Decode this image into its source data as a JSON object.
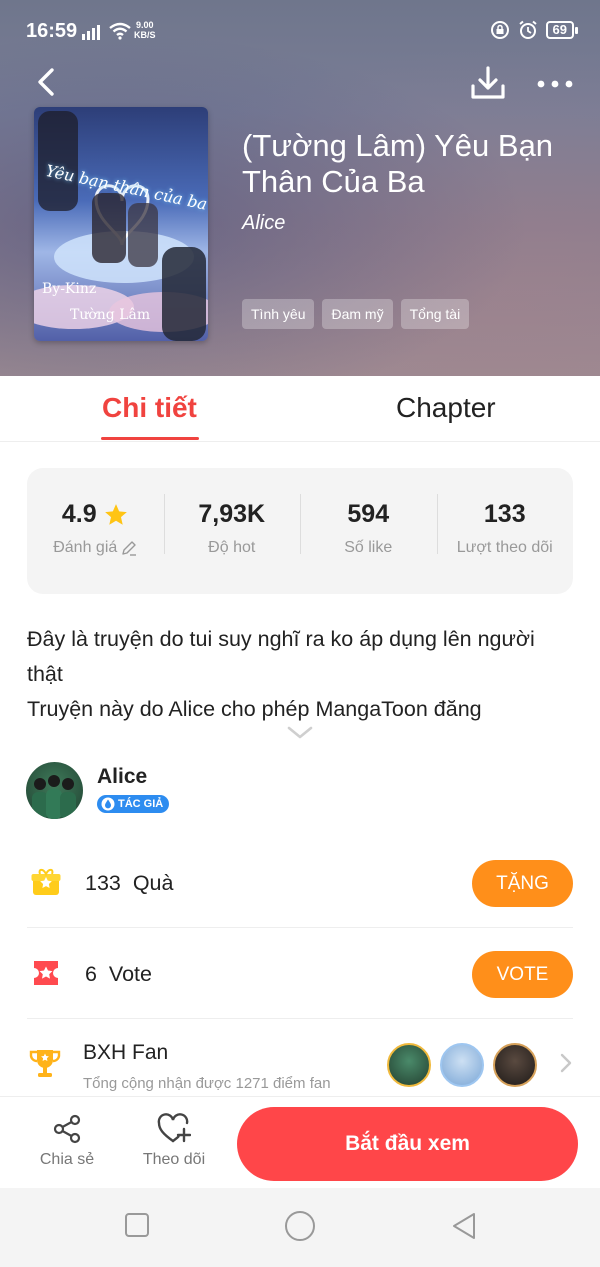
{
  "status_bar": {
    "time": "16:59",
    "net_speed_value": "9.00",
    "net_speed_unit": "KB/S",
    "battery": "69"
  },
  "header": {
    "back_icon": "chevron-left-icon",
    "download_icon": "download-icon",
    "more_icon": "more-dots-icon"
  },
  "cover": {
    "title_text": "Yêu bạn thân của ba",
    "by_text": "By-Kinz",
    "name_text": "Tường Lâm"
  },
  "book": {
    "title": "(Tường Lâm) Yêu Bạn Thân Của Ba",
    "author": "Alice",
    "tags": [
      "Tình yêu",
      "Đam mỹ",
      "Tổng tài"
    ]
  },
  "tabs": [
    {
      "label": "Chi tiết",
      "active": true
    },
    {
      "label": "Chapter",
      "active": false
    }
  ],
  "stats": [
    {
      "value": "4.9",
      "label": "Đánh giá",
      "icon": "star-icon",
      "label_icon": "pencil-icon"
    },
    {
      "value": "7,93K",
      "label": "Độ hot"
    },
    {
      "value": "594",
      "label": "Số like"
    },
    {
      "value": "133",
      "label": "Lượt theo dõi"
    }
  ],
  "description": {
    "line1": "Đây là truyện do tui suy nghĩ ra ko áp dụng lên người thật",
    "line2": "Truyện này do Alice cho phép MangaToon đăng"
  },
  "author_card": {
    "name": "Alice",
    "badge": "TÁC GIẢ"
  },
  "gifts": {
    "count": "133",
    "label": "Quà",
    "button": "TẶNG"
  },
  "votes": {
    "count": "6",
    "label": "Vote",
    "button": "VOTE"
  },
  "fan_ranking": {
    "title": "BXH Fan",
    "subtitle": "Tổng cộng nhận được 1271 điểm fan"
  },
  "bottom_bar": {
    "share_label": "Chia sẻ",
    "follow_label": "Theo dõi",
    "start_label": "Bắt đầu xem"
  },
  "colors": {
    "accent_red": "#f0433f",
    "button_orange": "#ff8f1a",
    "start_button": "#ff4649",
    "badge_blue": "#2d8cf0"
  }
}
